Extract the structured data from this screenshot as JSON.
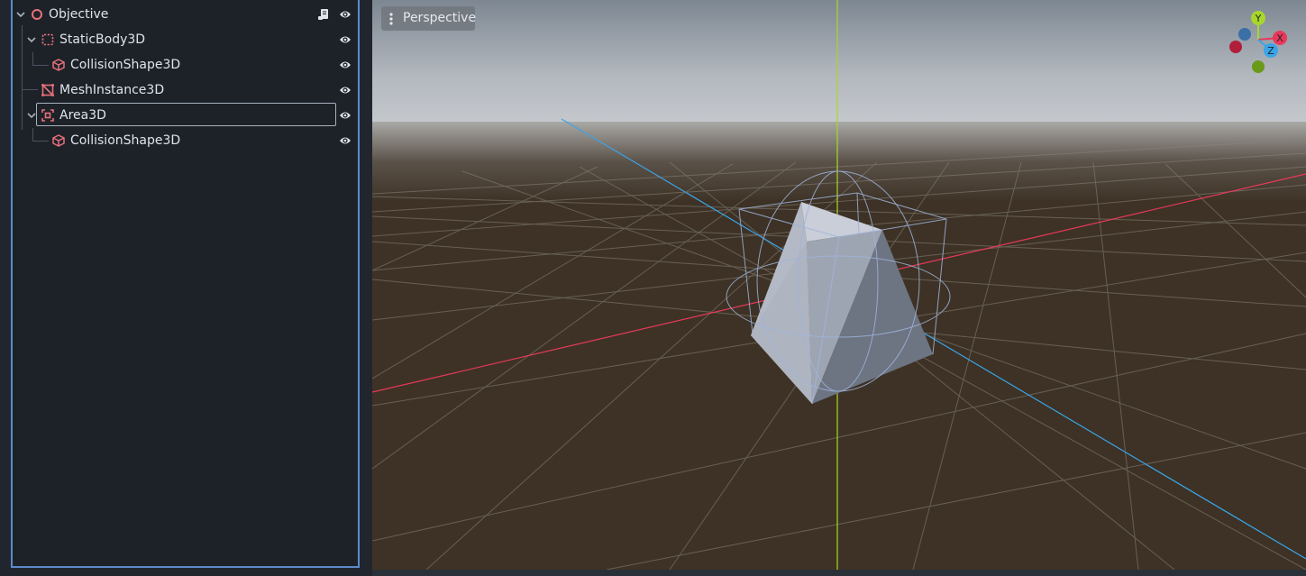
{
  "scene_tree": {
    "nodes": [
      {
        "label": "Objective",
        "icon": "node3d-icon",
        "eye_icon": "visibility-eye-icon",
        "has_script": true
      },
      {
        "label": "StaticBody3D",
        "icon": "staticbody3d-icon",
        "eye_icon": "visibility-eye-icon"
      },
      {
        "label": "CollisionShape3D",
        "icon": "collisionshape3d-icon",
        "eye_icon": "visibility-eye-icon"
      },
      {
        "label": "MeshInstance3D",
        "icon": "meshinstance3d-icon",
        "eye_icon": "visibility-eye-icon"
      },
      {
        "label": "Area3D",
        "icon": "area3d-icon",
        "eye_icon": "visibility-eye-icon",
        "selected": true
      },
      {
        "label": "CollisionShape3D",
        "icon": "collisionshape3d-icon",
        "eye_icon": "visibility-eye-icon"
      }
    ]
  },
  "viewport": {
    "view_menu_label": "Perspective",
    "gizmo": {
      "y": "Y",
      "x": "X",
      "z": "Z"
    }
  },
  "colors": {
    "node_icon": "#e8707a",
    "axis_x": "#e8385a",
    "axis_y": "#a8d72a",
    "axis_z": "#3aa4e8",
    "selection_border": "#5c8ac8"
  }
}
